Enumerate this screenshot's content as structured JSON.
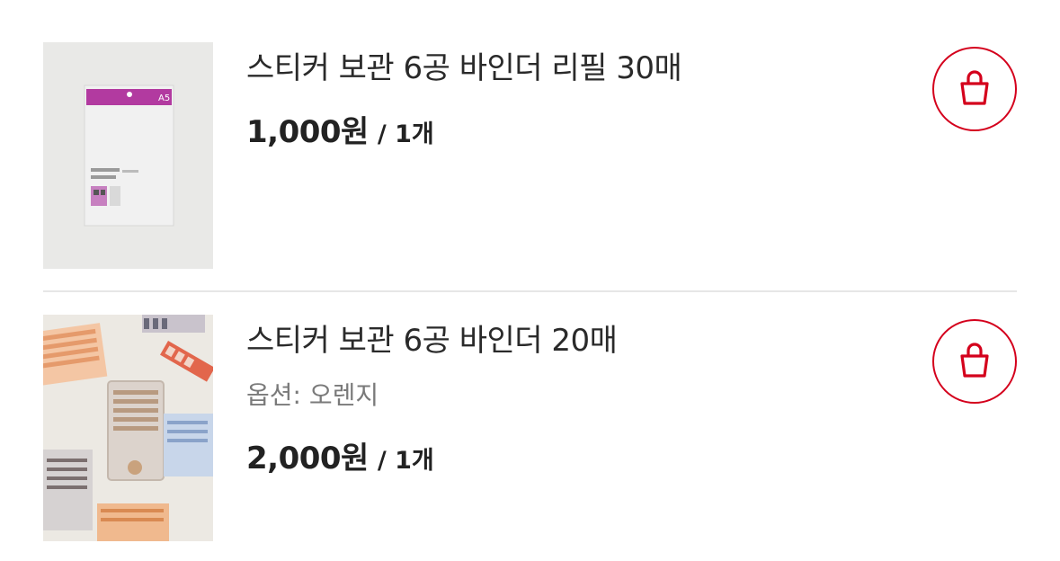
{
  "cart": {
    "items": [
      {
        "title": "스티커 보관 6공 바인더 리필 30매",
        "price": "1,000원",
        "quantity": "/ 1개",
        "thumbnail": "binder-refill-package-image",
        "thumb_label": "A5"
      },
      {
        "title": "스티커 보관 6공 바인더 20매",
        "option": "옵션: 오렌지",
        "price": "2,000원",
        "quantity": "/ 1개",
        "thumbnail": "sticker-binder-photo"
      }
    ],
    "cart_icon": "shopping-bag-icon",
    "accent_color": "#d4001c"
  }
}
